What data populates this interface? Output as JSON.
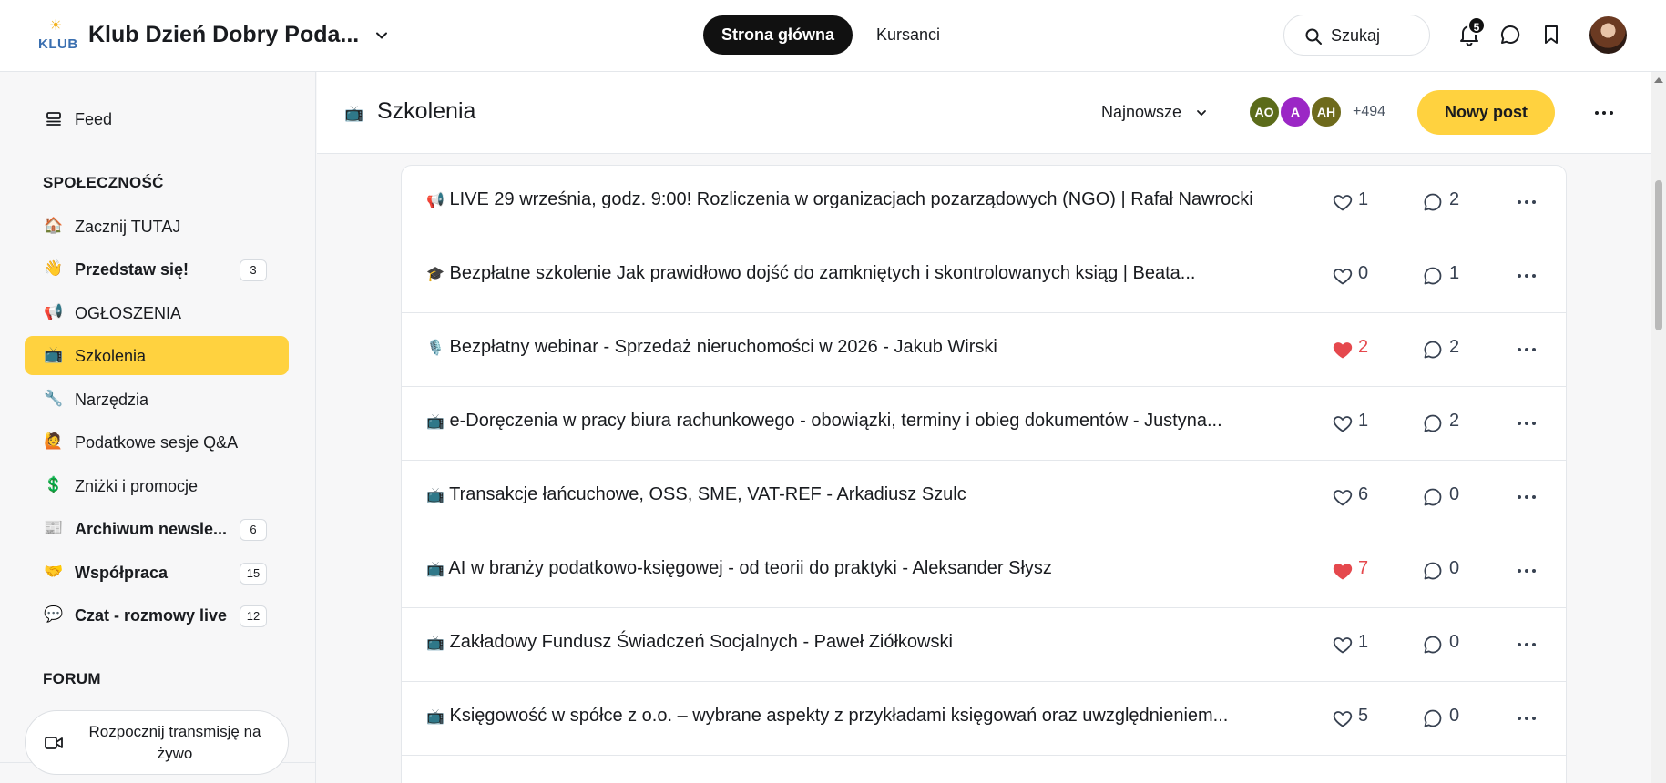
{
  "header": {
    "logo_text": "KLUB",
    "club_name": "Klub Dzień Dobry Poda...",
    "nav": [
      {
        "label": "Strona główna",
        "active": true
      },
      {
        "label": "Kursanci",
        "active": false
      }
    ],
    "search_label": "Szukaj",
    "notifications_count": "5",
    "icons": [
      "search-icon",
      "bell-icon",
      "chat-icon",
      "bookmark-icon",
      "chevron-down-icon"
    ]
  },
  "sidebar": {
    "feed_label": "Feed",
    "community_heading": "SPOŁECZNOŚĆ",
    "items": [
      {
        "emoji": "🏠",
        "label": "Zacznij TUTAJ",
        "bold": false,
        "count": ""
      },
      {
        "emoji": "👋",
        "label": "Przedstaw się!",
        "bold": true,
        "count": "3"
      },
      {
        "emoji": "📢",
        "label": "OGŁOSZENIA",
        "bold": false,
        "count": ""
      },
      {
        "emoji": "📺",
        "label": "Szkolenia",
        "bold": false,
        "count": "",
        "active": true
      },
      {
        "emoji": "🔧",
        "label": "Narzędzia",
        "bold": false,
        "count": ""
      },
      {
        "emoji": "🙋",
        "label": "Podatkowe sesje Q&A",
        "bold": false,
        "count": ""
      },
      {
        "emoji": "💲",
        "label": "Zniżki i promocje",
        "bold": false,
        "count": ""
      },
      {
        "emoji": "📰",
        "label": "Archiwum newsle...",
        "bold": true,
        "count": "6"
      },
      {
        "emoji": "🤝",
        "label": "Współpraca",
        "bold": true,
        "count": "15"
      },
      {
        "emoji": "💬",
        "label": "Czat - rozmowy live",
        "bold": true,
        "count": "12"
      }
    ],
    "forum_heading": "FORUM",
    "live_button_label": "Rozpocznij transmisję na żywo"
  },
  "space": {
    "icon": "📺",
    "title": "Szkolenia",
    "sort_label": "Najnowsze",
    "members": [
      {
        "initials": "AO",
        "color": "#5b6b1a"
      },
      {
        "initials": "A",
        "color": "#9b27c5"
      },
      {
        "initials": "AH",
        "color": "#6e6a1c"
      }
    ],
    "members_more": "+494",
    "new_post_label": "Nowy post",
    "accent_color": "#ffd23f"
  },
  "posts": [
    {
      "emoji": "📢",
      "title": "LIVE 29 września, godz. 9:00! Rozliczenia w organizacjach pozarządowych (NGO) | Rafał Nawrocki",
      "likes": "1",
      "liked": false,
      "comments": "2"
    },
    {
      "emoji": "🎓",
      "title": "Bezpłatne szkolenie Jak prawidłowo dojść do zamkniętych i skontrolowanych ksiąg | Beata...",
      "likes": "0",
      "liked": false,
      "comments": "1"
    },
    {
      "emoji": "🎙️",
      "title": "Bezpłatny webinar - Sprzedaż nieruchomości w 2026 - Jakub Wirski",
      "likes": "2",
      "liked": true,
      "comments": "2"
    },
    {
      "emoji": "📺",
      "title": "e-Doręczenia w pracy biura rachunkowego - obowiązki, terminy i obieg dokumentów - Justyna...",
      "likes": "1",
      "liked": false,
      "comments": "2"
    },
    {
      "emoji": "📺",
      "title": "Transakcje łańcuchowe, OSS, SME, VAT-REF - Arkadiusz Szulc",
      "likes": "6",
      "liked": false,
      "comments": "0"
    },
    {
      "emoji": "📺",
      "title": "AI w branży podatkowo-księgowej - od teorii do praktyki - Aleksander Słysz",
      "likes": "7",
      "liked": true,
      "comments": "0"
    },
    {
      "emoji": "📺",
      "title": "Zakładowy Fundusz Świadczeń Socjalnych - Paweł Ziółkowski",
      "likes": "1",
      "liked": false,
      "comments": "0"
    },
    {
      "emoji": "📺",
      "title": "Księgowość w spółce z o.o. – wybrane aspekty z przykładami księgowań oraz uwzględnieniem...",
      "likes": "5",
      "liked": false,
      "comments": "0"
    }
  ],
  "colors": {
    "liked": "#e5484d",
    "active_nav": "#111111"
  }
}
